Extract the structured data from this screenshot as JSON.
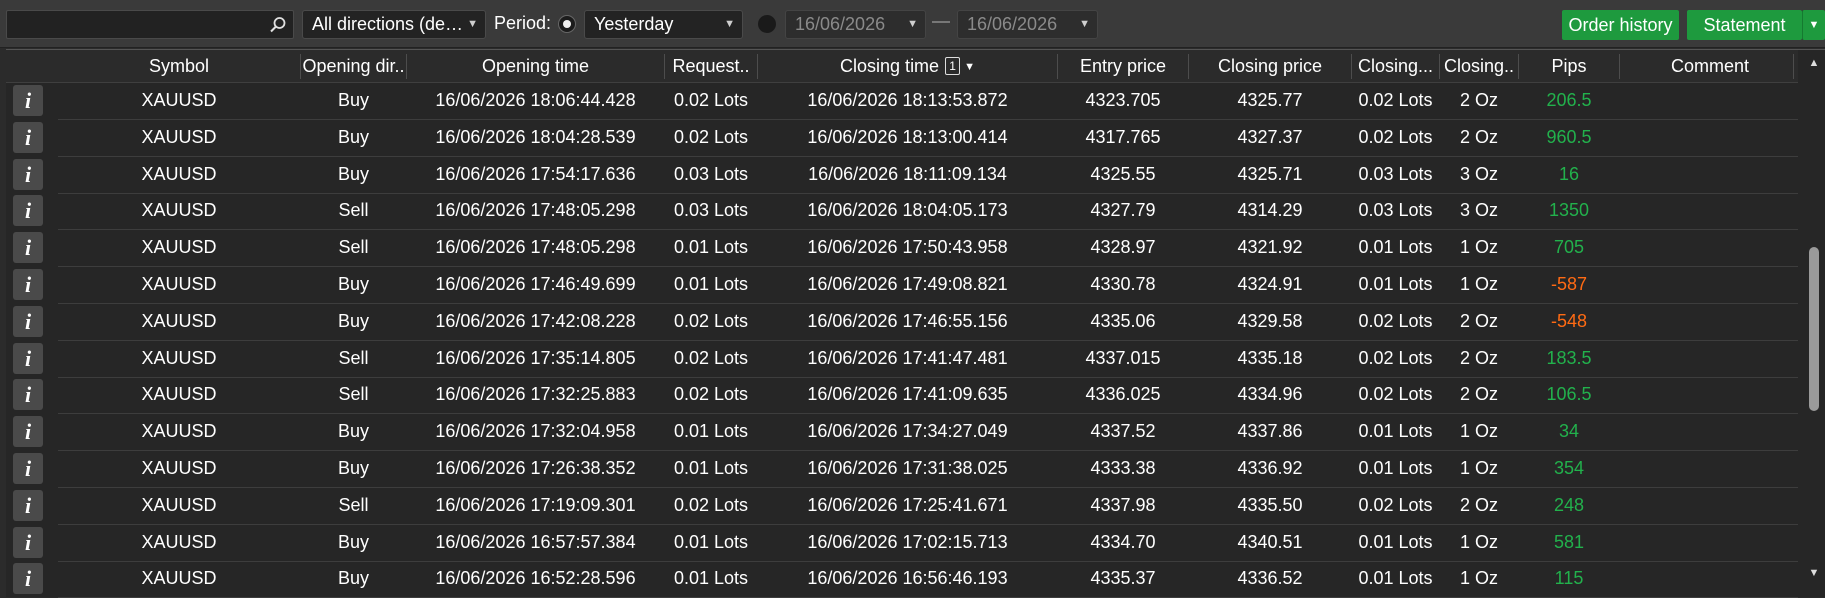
{
  "toolbar": {
    "search_value": "",
    "direction_filter": "All directions (de…",
    "period_label": "Period:",
    "period_preset": "Yesterday",
    "date_from": "16/06/2026",
    "date_separator": "—",
    "date_to": "16/06/2026",
    "order_history_label": "Order history",
    "statement_label": "Statement"
  },
  "table": {
    "headers": {
      "symbol": "Symbol",
      "opening_dir": "Opening dir..",
      "opening_time": "Opening time",
      "requested": "Request..",
      "closing_time": "Closing time",
      "sort_index": "1",
      "entry_price": "Entry price",
      "closing_price": "Closing price",
      "closing_lots": "Closing...",
      "closing_qty": "Closing..",
      "pips": "Pips",
      "comment": "Comment"
    },
    "rows": [
      {
        "symbol": "XAUUSD",
        "dir": "Buy",
        "open_time": "16/06/2026 18:06:44.428",
        "requested": "0.02 Lots",
        "close_time": "16/06/2026 18:13:53.872",
        "entry": "4323.705",
        "close_price": "4325.77",
        "close_lots": "0.02 Lots",
        "close_qty": "2 Oz",
        "pips": "206.5",
        "pips_sign": "pos",
        "comment": ""
      },
      {
        "symbol": "XAUUSD",
        "dir": "Buy",
        "open_time": "16/06/2026 18:04:28.539",
        "requested": "0.02 Lots",
        "close_time": "16/06/2026 18:13:00.414",
        "entry": "4317.765",
        "close_price": "4327.37",
        "close_lots": "0.02 Lots",
        "close_qty": "2 Oz",
        "pips": "960.5",
        "pips_sign": "pos",
        "comment": ""
      },
      {
        "symbol": "XAUUSD",
        "dir": "Buy",
        "open_time": "16/06/2026 17:54:17.636",
        "requested": "0.03 Lots",
        "close_time": "16/06/2026 18:11:09.134",
        "entry": "4325.55",
        "close_price": "4325.71",
        "close_lots": "0.03 Lots",
        "close_qty": "3 Oz",
        "pips": "16",
        "pips_sign": "pos",
        "comment": ""
      },
      {
        "symbol": "XAUUSD",
        "dir": "Sell",
        "open_time": "16/06/2026 17:48:05.298",
        "requested": "0.03 Lots",
        "close_time": "16/06/2026 18:04:05.173",
        "entry": "4327.79",
        "close_price": "4314.29",
        "close_lots": "0.03 Lots",
        "close_qty": "3 Oz",
        "pips": "1350",
        "pips_sign": "pos",
        "comment": ""
      },
      {
        "symbol": "XAUUSD",
        "dir": "Sell",
        "open_time": "16/06/2026 17:48:05.298",
        "requested": "0.01 Lots",
        "close_time": "16/06/2026 17:50:43.958",
        "entry": "4328.97",
        "close_price": "4321.92",
        "close_lots": "0.01 Lots",
        "close_qty": "1 Oz",
        "pips": "705",
        "pips_sign": "pos",
        "comment": ""
      },
      {
        "symbol": "XAUUSD",
        "dir": "Buy",
        "open_time": "16/06/2026 17:46:49.699",
        "requested": "0.01 Lots",
        "close_time": "16/06/2026 17:49:08.821",
        "entry": "4330.78",
        "close_price": "4324.91",
        "close_lots": "0.01 Lots",
        "close_qty": "1 Oz",
        "pips": "-587",
        "pips_sign": "neg",
        "comment": ""
      },
      {
        "symbol": "XAUUSD",
        "dir": "Buy",
        "open_time": "16/06/2026 17:42:08.228",
        "requested": "0.02 Lots",
        "close_time": "16/06/2026 17:46:55.156",
        "entry": "4335.06",
        "close_price": "4329.58",
        "close_lots": "0.02 Lots",
        "close_qty": "2 Oz",
        "pips": "-548",
        "pips_sign": "neg",
        "comment": ""
      },
      {
        "symbol": "XAUUSD",
        "dir": "Sell",
        "open_time": "16/06/2026 17:35:14.805",
        "requested": "0.02 Lots",
        "close_time": "16/06/2026 17:41:47.481",
        "entry": "4337.015",
        "close_price": "4335.18",
        "close_lots": "0.02 Lots",
        "close_qty": "2 Oz",
        "pips": "183.5",
        "pips_sign": "pos",
        "comment": ""
      },
      {
        "symbol": "XAUUSD",
        "dir": "Sell",
        "open_time": "16/06/2026 17:32:25.883",
        "requested": "0.02 Lots",
        "close_time": "16/06/2026 17:41:09.635",
        "entry": "4336.025",
        "close_price": "4334.96",
        "close_lots": "0.02 Lots",
        "close_qty": "2 Oz",
        "pips": "106.5",
        "pips_sign": "pos",
        "comment": ""
      },
      {
        "symbol": "XAUUSD",
        "dir": "Buy",
        "open_time": "16/06/2026 17:32:04.958",
        "requested": "0.01 Lots",
        "close_time": "16/06/2026 17:34:27.049",
        "entry": "4337.52",
        "close_price": "4337.86",
        "close_lots": "0.01 Lots",
        "close_qty": "1 Oz",
        "pips": "34",
        "pips_sign": "pos",
        "comment": ""
      },
      {
        "symbol": "XAUUSD",
        "dir": "Buy",
        "open_time": "16/06/2026 17:26:38.352",
        "requested": "0.01 Lots",
        "close_time": "16/06/2026 17:31:38.025",
        "entry": "4333.38",
        "close_price": "4336.92",
        "close_lots": "0.01 Lots",
        "close_qty": "1 Oz",
        "pips": "354",
        "pips_sign": "pos",
        "comment": ""
      },
      {
        "symbol": "XAUUSD",
        "dir": "Sell",
        "open_time": "16/06/2026 17:19:09.301",
        "requested": "0.02 Lots",
        "close_time": "16/06/2026 17:25:41.671",
        "entry": "4337.98",
        "close_price": "4335.50",
        "close_lots": "0.02 Lots",
        "close_qty": "2 Oz",
        "pips": "248",
        "pips_sign": "pos",
        "comment": ""
      },
      {
        "symbol": "XAUUSD",
        "dir": "Buy",
        "open_time": "16/06/2026 16:57:57.384",
        "requested": "0.01 Lots",
        "close_time": "16/06/2026 17:02:15.713",
        "entry": "4334.70",
        "close_price": "4340.51",
        "close_lots": "0.01 Lots",
        "close_qty": "1 Oz",
        "pips": "581",
        "pips_sign": "pos",
        "comment": ""
      },
      {
        "symbol": "XAUUSD",
        "dir": "Buy",
        "open_time": "16/06/2026 16:52:28.596",
        "requested": "0.01 Lots",
        "close_time": "16/06/2026 16:56:46.193",
        "entry": "4335.37",
        "close_price": "4336.52",
        "close_lots": "0.01 Lots",
        "close_qty": "1 Oz",
        "pips": "115",
        "pips_sign": "pos",
        "comment": ""
      }
    ]
  },
  "colors": {
    "positive": "#22b14c",
    "negative": "#ff6a13",
    "accent_green": "#1e9a3e"
  },
  "icons": {
    "search": "search-icon",
    "info": "info-icon",
    "dropdown": "chevron-down-icon",
    "sort_desc": "sort-desc-icon"
  }
}
